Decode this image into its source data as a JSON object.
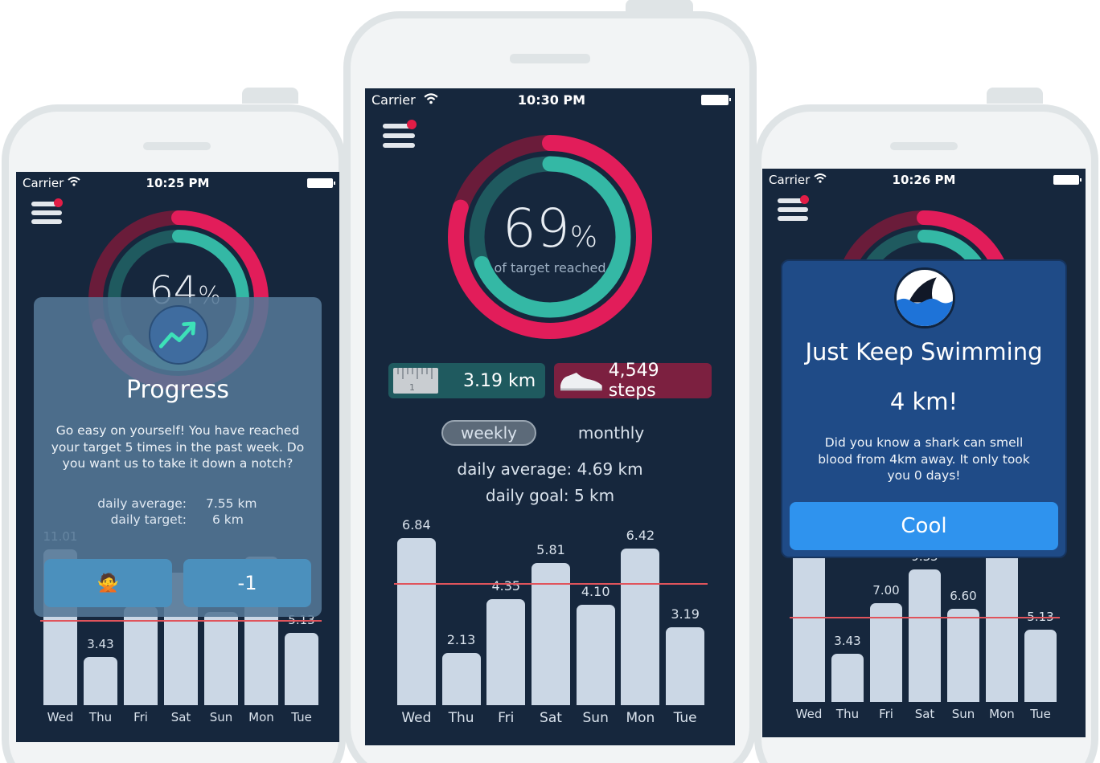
{
  "colors": {
    "screen_bg": "#16273d",
    "ring_outer": "#e21d5a",
    "ring_inner": "#34b8a5",
    "distance_pill": "#1f5a5f",
    "steps_pill": "#7c2040",
    "bar": "#cbd7e5",
    "goal_line": "#e0545c",
    "cool_button": "#2f93ee"
  },
  "left_phone": {
    "status": {
      "carrier": "Carrier",
      "time": "10:25 PM"
    },
    "ring": {
      "percent": 64,
      "big_text": "64",
      "unit": "%"
    },
    "chart": {
      "days": [
        "Wed",
        "Thu",
        "Fri",
        "Sat",
        "Sun",
        "Mon",
        "Tue"
      ],
      "values": [
        11.01,
        3.43,
        7.0,
        9.35,
        6.6,
        10.5,
        5.13
      ],
      "labels": [
        "11.01",
        "3.43",
        "7.00",
        "",
        "6.60",
        "",
        "5.13"
      ],
      "goal": 6
    },
    "modal": {
      "icon": "trending-up-icon",
      "title": "Progress",
      "message": "Go easy on yourself! You have reached your target 5 times in the past week. Do you want us to take it down a notch?",
      "stats": [
        {
          "label": "daily average:",
          "value": "7.55 km"
        },
        {
          "label": "daily target:",
          "value": "6 km"
        }
      ],
      "decline_button": "🙅",
      "accept_button": "-1"
    }
  },
  "center_phone": {
    "status": {
      "carrier": "Carrier",
      "time": "10:30 PM"
    },
    "ring": {
      "percent": 69,
      "big_text": "69",
      "unit": "%",
      "caption": "of target reached"
    },
    "distance": "3.19 km",
    "steps": "4,549 steps",
    "toggle": {
      "weekly": "weekly",
      "monthly": "monthly",
      "selected": "weekly"
    },
    "daily_average": "daily average: 4.69 km",
    "daily_goal": "daily goal: 5 km",
    "chart": {
      "days": [
        "Wed",
        "Thu",
        "Fri",
        "Sat",
        "Sun",
        "Mon",
        "Tue"
      ],
      "values": [
        6.84,
        2.13,
        4.35,
        5.81,
        4.1,
        6.42,
        3.19
      ],
      "labels": [
        "6.84",
        "2.13",
        "4.35",
        "5.81",
        "4.10",
        "6.42",
        "3.19"
      ],
      "goal": 5
    }
  },
  "right_phone": {
    "status": {
      "carrier": "Carrier",
      "time": "10:26 PM"
    },
    "chart": {
      "days": [
        "Wed",
        "Thu",
        "Fri",
        "Sat",
        "Sun",
        "Mon",
        "Tue"
      ],
      "values": [
        11.01,
        3.43,
        7.0,
        9.35,
        6.6,
        10.53,
        5.13
      ],
      "labels": [
        "",
        "3.43",
        "7.00",
        "9.35",
        "6.60",
        "",
        "5.13"
      ],
      "goal": 6
    },
    "modal": {
      "icon": "shark-fin-icon",
      "title": "Just Keep Swimming",
      "subtitle": "4 km!",
      "message": "Did you know a shark can smell blood from 4km away. It only took you 0 days!",
      "button": "Cool"
    }
  }
}
